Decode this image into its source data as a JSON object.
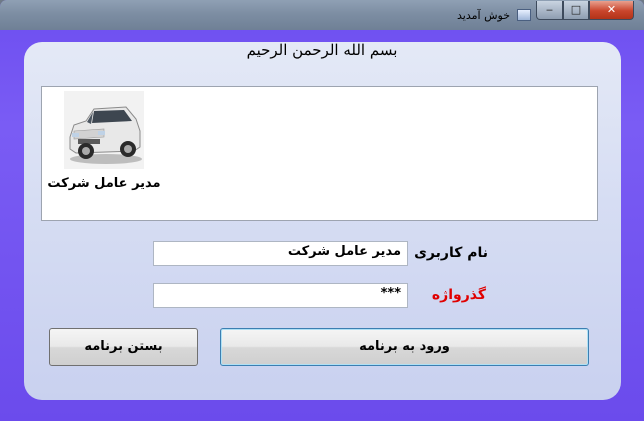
{
  "window": {
    "title": "خوش آمدید",
    "colors": {
      "frame": "#6d4ef0",
      "client": "#d6ddf3",
      "password_label": "#e00000"
    }
  },
  "header": {
    "bismillah": "بسم الله الرحمن الرحیم"
  },
  "users": [
    {
      "label": "مدیر عامل شرکت",
      "image": "car-photo"
    }
  ],
  "form": {
    "username_label": "نام کاربری",
    "username_value": "مدیر عامل شرکت",
    "password_label": "گذرواژه",
    "password_value": "***"
  },
  "buttons": {
    "login": "ورود به برنامه",
    "close": "بستن برنامه"
  },
  "controls": {
    "minimize": "‒",
    "maximize": "□",
    "close": "✕"
  }
}
